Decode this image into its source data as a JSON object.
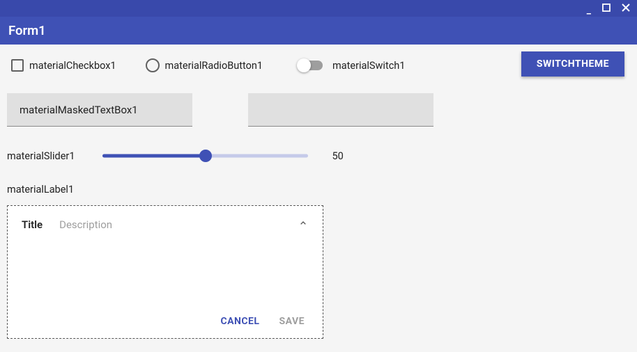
{
  "window": {
    "title": "Form1"
  },
  "checkbox": {
    "label": "materialCheckbox1",
    "checked": false
  },
  "radio": {
    "label": "materialRadioButton1",
    "checked": false
  },
  "switch": {
    "label": "materialSwitch1",
    "on": false
  },
  "themeButton": {
    "label": "SWITCHTHEME"
  },
  "maskedTextBox": {
    "value": "materialMaskedTextBox1"
  },
  "textBox2": {
    "value": ""
  },
  "slider": {
    "label": "materialSlider1",
    "value": 50,
    "min": 0,
    "max": 100
  },
  "label1": {
    "text": "materialLabel1"
  },
  "card": {
    "title": "Title",
    "description": "Description",
    "expanded": true,
    "actions": {
      "cancel": "CANCEL",
      "save": "SAVE"
    }
  },
  "colors": {
    "primary": "#3f51b5",
    "primaryDark": "#3949ab"
  }
}
